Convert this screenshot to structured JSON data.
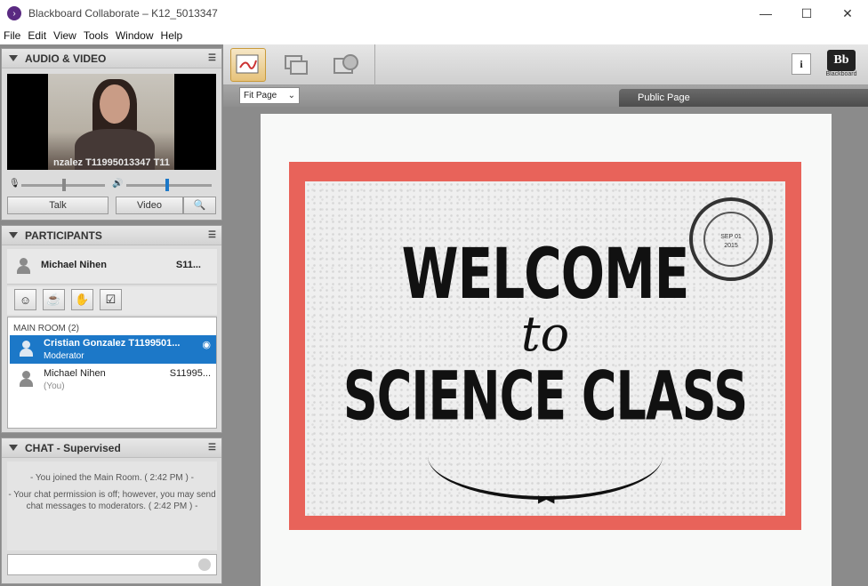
{
  "window": {
    "title": "Blackboard Collaborate – K12_5013347",
    "controls": {
      "minimize": "—",
      "maximize": "☐",
      "close": "✕"
    }
  },
  "menu": [
    "File",
    "Edit",
    "View",
    "Tools",
    "Window",
    "Help"
  ],
  "audio_video": {
    "title": "AUDIO & VIDEO",
    "video_caption": "nzalez T11995013347 T11",
    "talk_label": "Talk",
    "video_label": "Video"
  },
  "participants": {
    "title": "PARTICIPANTS",
    "me": {
      "name": "Michael Nihen",
      "id": "S11..."
    },
    "room_label": "MAIN ROOM",
    "room_count": "(2)",
    "list": [
      {
        "name": "Cristian Gonzalez T1199501...",
        "role": "Moderator",
        "id": "",
        "selected": true
      },
      {
        "name": "Michael Nihen",
        "role": "(You)",
        "id": "S11995...",
        "selected": false
      }
    ]
  },
  "chat": {
    "title": "CHAT - Supervised",
    "messages": [
      "- You joined the Main Room. ( 2:42 PM ) -",
      "- Your chat permission is off; however, you may send chat messages to moderators. ( 2:42 PM ) -"
    ]
  },
  "whiteboard": {
    "fit_page_label": "Fit Page",
    "public_page_label": "Public Page",
    "info_label": "i",
    "logo_mark": "Bb",
    "logo_text": "Blackboard"
  },
  "slide": {
    "line1": "WELCOME",
    "line2": "to",
    "line3": "SCIENCE CLASS",
    "stamp_date": "SEP 01",
    "stamp_year": "2015"
  },
  "colors": {
    "selected_row": "#1c78c8",
    "slide_border": "#e8635a",
    "app_icon": "#5a2a82"
  }
}
